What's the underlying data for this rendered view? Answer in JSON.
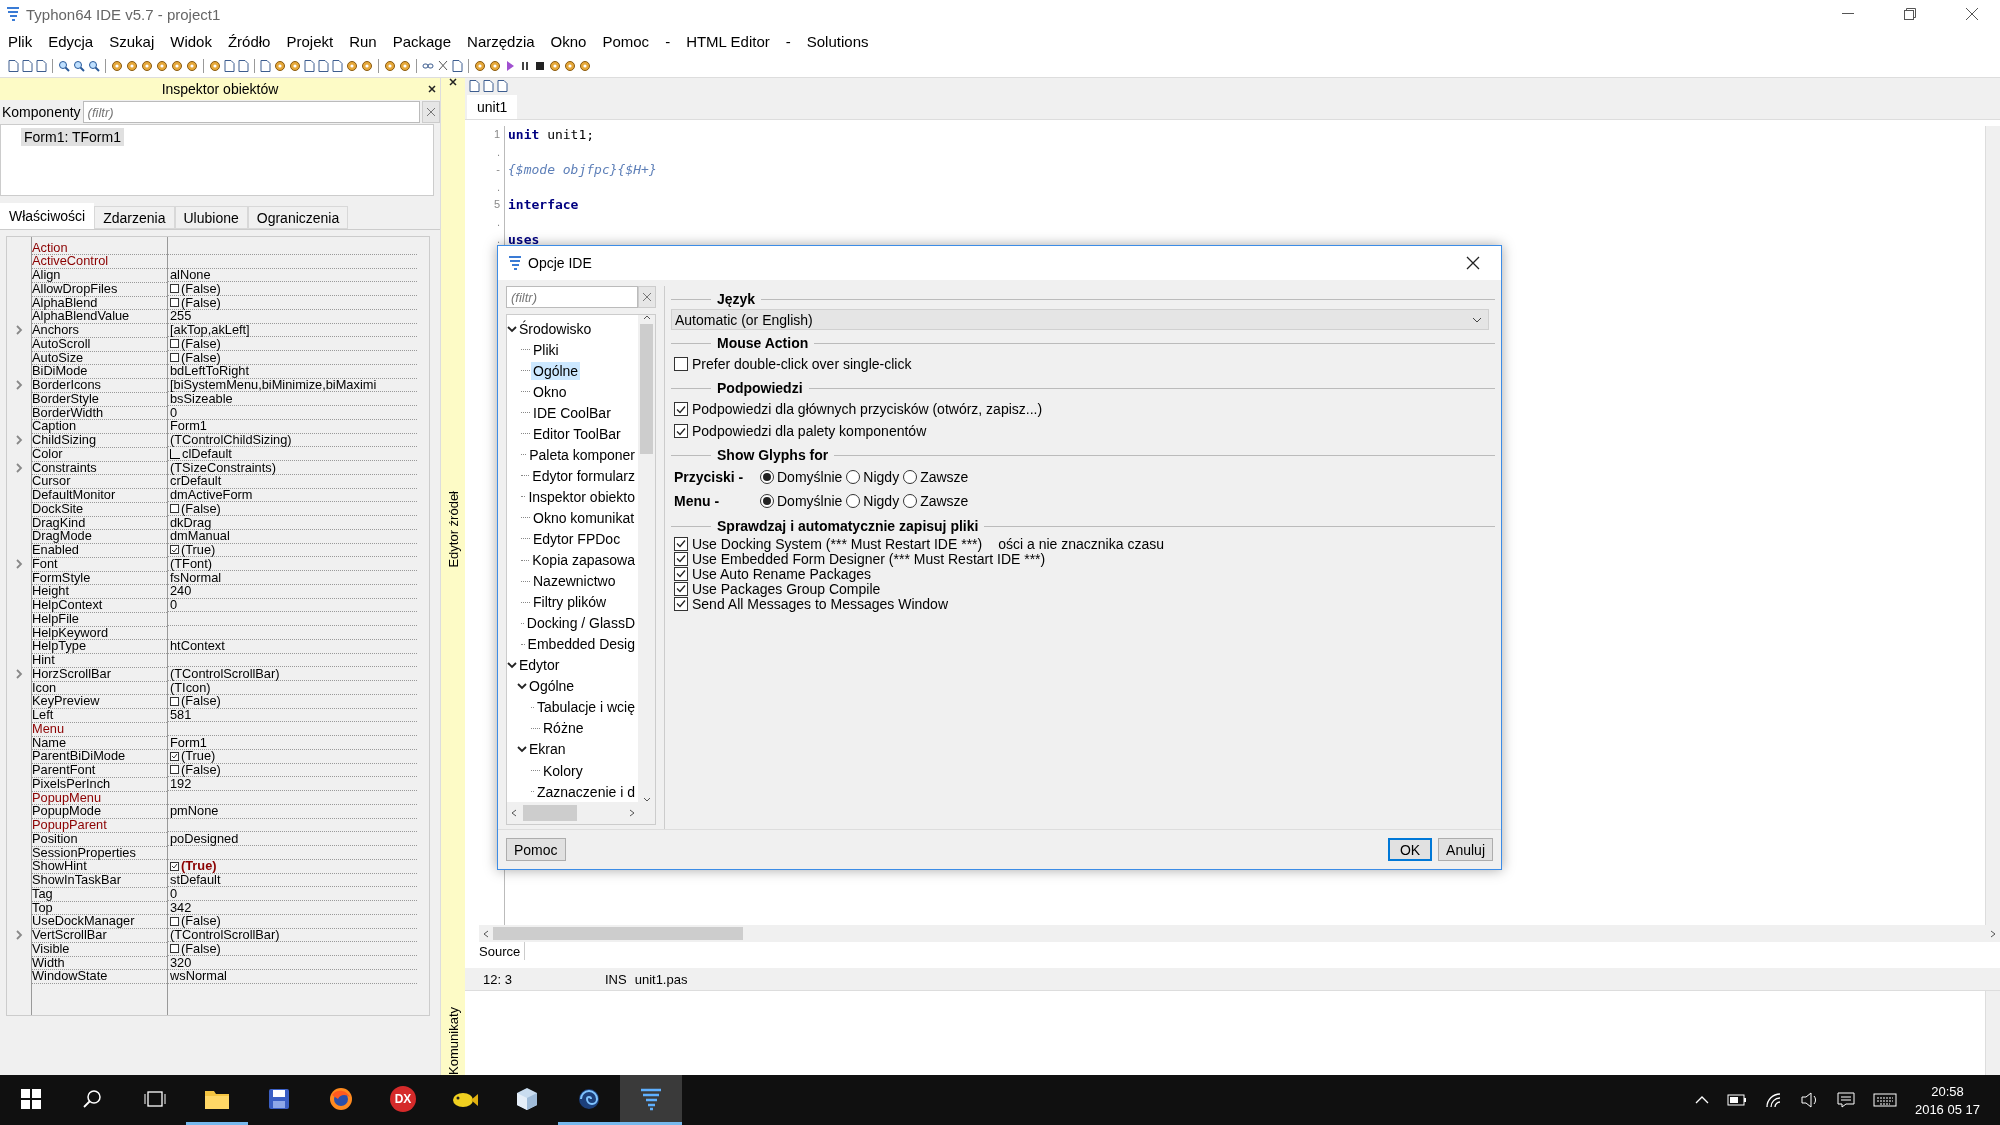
{
  "window": {
    "title": "Typhon64 IDE v5.7 - project1"
  },
  "menu": [
    "Plik",
    "Edycja",
    "Szukaj",
    "Widok",
    "Źródło",
    "Projekt",
    "Run",
    "Package",
    "Narzędzia",
    "Okno",
    "Pomoc",
    "-",
    "HTML Editor",
    "-",
    "Solutions"
  ],
  "inspector": {
    "title": "Inspektor obiektów",
    "components_label": "Komponenty",
    "filter": {
      "placeholder": "(filtr)"
    },
    "tree": [
      {
        "label": "Form1: TForm1",
        "selected": true
      }
    ],
    "tabs": [
      {
        "label": "Właściwości",
        "selected": true
      },
      {
        "label": "Zdarzenia",
        "selected": false
      },
      {
        "label": "Ulubione",
        "selected": false
      },
      {
        "label": "Ograniczenia",
        "selected": false
      }
    ],
    "properties": [
      {
        "name": "Action",
        "kind": "text",
        "reference": true,
        "expandable": false
      },
      {
        "name": "ActiveControl",
        "kind": "text",
        "reference": true,
        "expandable": false
      },
      {
        "name": "Align",
        "value": "alNone",
        "kind": "text",
        "reference": false,
        "expandable": false,
        "modified": false
      },
      {
        "name": "AllowDropFiles",
        "value": "(False)",
        "kind": "bool",
        "checked": false,
        "reference": false,
        "expandable": false,
        "modified": false
      },
      {
        "name": "AlphaBlend",
        "value": "(False)",
        "kind": "bool",
        "checked": false,
        "reference": false,
        "expandable": false,
        "modified": false
      },
      {
        "name": "AlphaBlendValue",
        "value": "255",
        "kind": "text",
        "reference": false,
        "expandable": false,
        "modified": false
      },
      {
        "name": "Anchors",
        "value": "[akTop,akLeft]",
        "kind": "text",
        "reference": false,
        "expandable": true,
        "modified": false
      },
      {
        "name": "AutoScroll",
        "value": "(False)",
        "kind": "bool",
        "checked": false,
        "reference": false,
        "expandable": false,
        "modified": false
      },
      {
        "name": "AutoSize",
        "value": "(False)",
        "kind": "bool",
        "checked": false,
        "reference": false,
        "expandable": false,
        "modified": false
      },
      {
        "name": "BiDiMode",
        "value": "bdLeftToRight",
        "kind": "text",
        "reference": false,
        "expandable": false,
        "modified": false
      },
      {
        "name": "BorderIcons",
        "value": "[biSystemMenu,biMinimize,biMaximi",
        "kind": "text",
        "reference": false,
        "expandable": true,
        "modified": false
      },
      {
        "name": "BorderStyle",
        "value": "bsSizeable",
        "kind": "text",
        "reference": false,
        "expandable": false,
        "modified": false
      },
      {
        "name": "BorderWidth",
        "value": "0",
        "kind": "text",
        "reference": false,
        "expandable": false,
        "modified": false
      },
      {
        "name": "Caption",
        "value": "Form1",
        "kind": "text",
        "reference": false,
        "expandable": false,
        "modified": false
      },
      {
        "name": "ChildSizing",
        "value": "(TControlChildSizing)",
        "kind": "text",
        "reference": false,
        "expandable": true,
        "modified": false
      },
      {
        "name": "Color",
        "value": "clDefault",
        "kind": "color",
        "reference": false,
        "expandable": false,
        "modified": false
      },
      {
        "name": "Constraints",
        "value": "(TSizeConstraints)",
        "kind": "text",
        "reference": false,
        "expandable": true,
        "modified": false
      },
      {
        "name": "Cursor",
        "value": "crDefault",
        "kind": "text",
        "reference": false,
        "expandable": false,
        "modified": false
      },
      {
        "name": "DefaultMonitor",
        "value": "dmActiveForm",
        "kind": "text",
        "reference": false,
        "expandable": false,
        "modified": false
      },
      {
        "name": "DockSite",
        "value": "(False)",
        "kind": "bool",
        "checked": false,
        "reference": false,
        "expandable": false,
        "modified": false
      },
      {
        "name": "DragKind",
        "value": "dkDrag",
        "kind": "text",
        "reference": false,
        "expandable": false,
        "modified": false
      },
      {
        "name": "DragMode",
        "value": "dmManual",
        "kind": "text",
        "reference": false,
        "expandable": false,
        "modified": false
      },
      {
        "name": "Enabled",
        "value": "(True)",
        "kind": "bool",
        "checked": true,
        "reference": false,
        "expandable": false,
        "modified": false
      },
      {
        "name": "Font",
        "value": "(TFont)",
        "kind": "text",
        "reference": false,
        "expandable": true,
        "modified": false
      },
      {
        "name": "FormStyle",
        "value": "fsNormal",
        "kind": "text",
        "reference": false,
        "expandable": false,
        "modified": false
      },
      {
        "name": "Height",
        "value": "240",
        "kind": "text",
        "reference": false,
        "expandable": false,
        "modified": false
      },
      {
        "name": "HelpContext",
        "value": "0",
        "kind": "text",
        "reference": false,
        "expandable": false,
        "modified": false
      },
      {
        "name": "HelpFile",
        "kind": "text",
        "reference": false,
        "expandable": false
      },
      {
        "name": "HelpKeyword",
        "kind": "text",
        "reference": false,
        "expandable": false
      },
      {
        "name": "HelpType",
        "value": "htContext",
        "kind": "text",
        "reference": false,
        "expandable": false,
        "modified": false
      },
      {
        "name": "Hint",
        "kind": "text",
        "reference": false,
        "expandable": false
      },
      {
        "name": "HorzScrollBar",
        "value": "(TControlScrollBar)",
        "kind": "text",
        "reference": false,
        "expandable": true,
        "modified": false
      },
      {
        "name": "Icon",
        "value": "(TIcon)",
        "kind": "text",
        "reference": false,
        "expandable": false,
        "modified": false
      },
      {
        "name": "KeyPreview",
        "value": "(False)",
        "kind": "bool",
        "checked": false,
        "reference": false,
        "expandable": false,
        "modified": false
      },
      {
        "name": "Left",
        "value": "581",
        "kind": "text",
        "reference": false,
        "expandable": false,
        "modified": false
      },
      {
        "name": "Menu",
        "kind": "text",
        "reference": true,
        "expandable": false
      },
      {
        "name": "Name",
        "value": "Form1",
        "kind": "text",
        "reference": false,
        "expandable": false,
        "modified": false
      },
      {
        "name": "ParentBiDiMode",
        "value": "(True)",
        "kind": "bool",
        "checked": true,
        "reference": false,
        "expandable": false,
        "modified": false
      },
      {
        "name": "ParentFont",
        "value": "(False)",
        "kind": "bool",
        "checked": false,
        "reference": false,
        "expandable": false,
        "modified": false
      },
      {
        "name": "PixelsPerInch",
        "value": "192",
        "kind": "text",
        "reference": false,
        "expandable": false,
        "modified": false
      },
      {
        "name": "PopupMenu",
        "kind": "text",
        "reference": true,
        "expandable": false
      },
      {
        "name": "PopupMode",
        "value": "pmNone",
        "kind": "text",
        "reference": false,
        "expandable": false,
        "modified": false
      },
      {
        "name": "PopupParent",
        "kind": "text",
        "reference": true,
        "expandable": false
      },
      {
        "name": "Position",
        "value": "poDesigned",
        "kind": "text",
        "reference": false,
        "expandable": false,
        "modified": false
      },
      {
        "name": "SessionProperties",
        "kind": "text",
        "reference": false,
        "expandable": false
      },
      {
        "name": "ShowHint",
        "value": "(True)",
        "kind": "bool",
        "checked": true,
        "reference": false,
        "expandable": false,
        "modified": true
      },
      {
        "name": "ShowInTaskBar",
        "value": "stDefault",
        "kind": "text",
        "reference": false,
        "expandable": false,
        "modified": false
      },
      {
        "name": "Tag",
        "value": "0",
        "kind": "text",
        "reference": false,
        "expandable": false,
        "modified": false
      },
      {
        "name": "Top",
        "value": "342",
        "kind": "text",
        "reference": false,
        "expandable": false,
        "modified": false
      },
      {
        "name": "UseDockManager",
        "value": "(False)",
        "kind": "bool",
        "checked": false,
        "reference": false,
        "expandable": false,
        "modified": false
      },
      {
        "name": "VertScrollBar",
        "value": "(TControlScrollBar)",
        "kind": "text",
        "reference": false,
        "expandable": true,
        "modified": false
      },
      {
        "name": "Visible",
        "value": "(False)",
        "kind": "bool",
        "checked": false,
        "reference": false,
        "expandable": false,
        "modified": false
      },
      {
        "name": "Width",
        "value": "320",
        "kind": "text",
        "reference": false,
        "expandable": false,
        "modified": false
      },
      {
        "name": "WindowState",
        "value": "wsNormal",
        "kind": "text",
        "reference": false,
        "expandable": false,
        "modified": false
      }
    ]
  },
  "side_labels": {
    "editor": "Edytor źródeł",
    "messages": "Komunikaty"
  },
  "editor": {
    "tabs": [
      {
        "label": "unit1",
        "selected": true
      }
    ],
    "lines": [
      {
        "gutter": "1",
        "text": "**unit** unit1;",
        "kind": "code"
      },
      {
        "gutter": ".",
        "kind": "blank"
      },
      {
        "gutter": "-",
        "text": "{$mode objfpc}{$H+}",
        "kind": "directive"
      },
      {
        "gutter": ".",
        "kind": "blank"
      },
      {
        "gutter": "5",
        "text": "**interface**",
        "kind": "code"
      },
      {
        "gutter": ".",
        "kind": "blank"
      },
      {
        "gutter": ".",
        "text": "**uses**",
        "kind": "code"
      }
    ],
    "bottom_tab": "Source",
    "status": {
      "position": "12: 3",
      "mode": "INS",
      "file": "unit1.pas"
    }
  },
  "dialog": {
    "title": "Opcje IDE",
    "filter": {
      "placeholder": "(filtr)"
    },
    "tree": [
      {
        "label": "Środowisko",
        "expanded": true,
        "selected": false,
        "children": [
          {
            "label": "Pliki",
            "selected": false
          },
          {
            "label": "Ogólne",
            "selected": true
          },
          {
            "label": "Okno",
            "selected": false
          },
          {
            "label": "IDE CoolBar",
            "selected": false
          },
          {
            "label": "Editor ToolBar",
            "selected": false
          },
          {
            "label": "Paleta komponer",
            "selected": false
          },
          {
            "label": "Edytor formularz",
            "selected": false
          },
          {
            "label": "Inspektor obiekto",
            "selected": false
          },
          {
            "label": "Okno komunikat",
            "selected": false
          },
          {
            "label": "Edytor FPDoc",
            "selected": false
          },
          {
            "label": "Kopia zapasowa",
            "selected": false
          },
          {
            "label": "Nazewnictwo",
            "selected": false
          },
          {
            "label": "Filtry plików",
            "selected": false
          },
          {
            "label": "Docking / GlassD",
            "selected": false
          },
          {
            "label": "Embedded Desig",
            "selected": false
          }
        ]
      },
      {
        "label": "Edytor",
        "expanded": true,
        "selected": false,
        "children": [
          {
            "label": "Ogólne",
            "expanded": true,
            "selected": false,
            "children": [
              {
                "label": "Tabulacje i wcię",
                "selected": false
              },
              {
                "label": "Różne",
                "selected": false
              }
            ]
          },
          {
            "label": "Ekran",
            "expanded": true,
            "selected": false,
            "children": [
              {
                "label": "Kolory",
                "selected": false
              },
              {
                "label": "Zaznaczenie i d",
                "selected": false
              }
            ]
          }
        ]
      }
    ],
    "sections": [
      {
        "kind": "dropdown",
        "title": "Język",
        "value": "Automatic (or English)"
      },
      {
        "kind": "checks",
        "title": "Mouse Action",
        "items": [
          {
            "label": "Prefer double-click over single-click",
            "checked": false
          }
        ]
      },
      {
        "kind": "checks",
        "title": "Podpowiedzi",
        "items": [
          {
            "label": "Podpowiedzi dla głównych przycisków (otwórz, zapisz...)",
            "checked": true
          },
          {
            "label": "Podpowiedzi dla palety komponentów",
            "checked": true
          }
        ]
      },
      {
        "kind": "radios",
        "title": "Show Glyphs for",
        "groups": [
          {
            "label": "Przyciski -",
            "options": [
              {
                "label": "Domyślnie",
                "selected": true
              },
              {
                "label": "Nigdy",
                "selected": false
              },
              {
                "label": "Zawsze",
                "selected": false
              }
            ]
          },
          {
            "label": "Menu -",
            "options": [
              {
                "label": "Domyślnie",
                "selected": true
              },
              {
                "label": "Nigdy",
                "selected": false
              },
              {
                "label": "Zawsze",
                "selected": false
              }
            ]
          }
        ]
      },
      {
        "kind": "dense-checks",
        "title": "Sprawdzaj i automatycznie zapisuj pliki",
        "items": [
          {
            "label": "Use Docking System   (*** Must Restart IDE ***)",
            "checked": true,
            "note": "ości a nie znacznika czasu"
          },
          {
            "label": "Use Embedded Form Designer (*** Must Restart IDE ***)",
            "checked": true
          },
          {
            "label": "Use Auto Rename Packages",
            "checked": true
          },
          {
            "label": "Use Packages Group Compile",
            "checked": true
          },
          {
            "label": "Send All Messages to Messages Window",
            "checked": true
          }
        ]
      }
    ],
    "buttons": [
      {
        "label": "Pomoc",
        "kind": "help"
      },
      {
        "label": "OK",
        "kind": "default"
      },
      {
        "label": "Anuluj",
        "kind": "normal"
      }
    ]
  },
  "taskbar": {
    "apps": [
      {
        "kind": "folder",
        "running": true,
        "selected": false
      },
      {
        "kind": "floppy",
        "running": false,
        "selected": false
      },
      {
        "kind": "browser",
        "running": false,
        "selected": false
      },
      {
        "kind": "badge",
        "label": "DX",
        "running": false,
        "selected": false
      },
      {
        "kind": "fish",
        "running": false,
        "selected": false
      },
      {
        "kind": "cube",
        "running": false,
        "selected": false
      },
      {
        "kind": "swirl",
        "running": true,
        "selected": false
      },
      {
        "kind": "tornado",
        "running": true,
        "selected": true
      }
    ],
    "time": "20:58",
    "date": "2016 05 17"
  }
}
